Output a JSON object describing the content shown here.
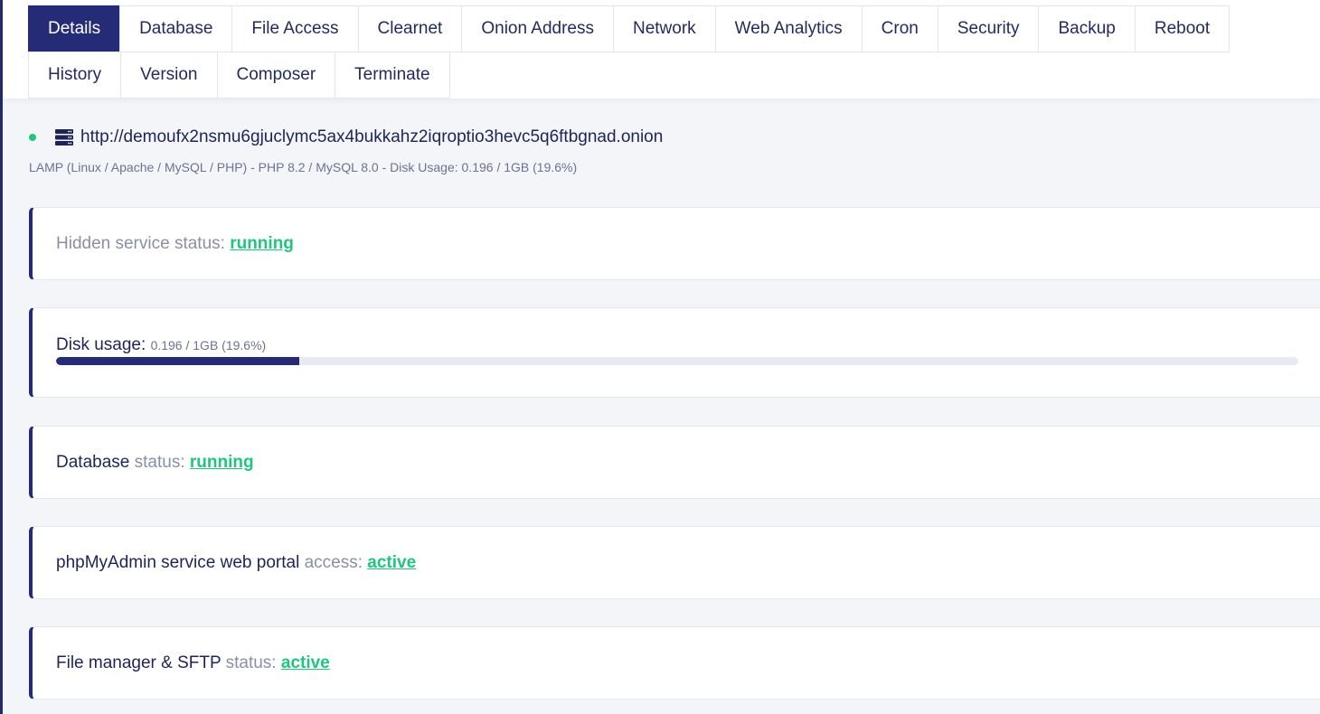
{
  "tabs_row1": [
    "Details",
    "Database",
    "File Access",
    "Clearnet",
    "Onion Address",
    "Network",
    "Web Analytics",
    "Cron",
    "Security",
    "Backup",
    "Reboot"
  ],
  "tabs_row2": [
    "History",
    "Version",
    "Composer",
    "Terminate"
  ],
  "active_tab": "Details",
  "server": {
    "url": "http://demoufx2nsmu6gjuclymc5ax4bukkahz2iqroptio3hevc5q6ftbgnad.onion",
    "info": "LAMP (Linux / Apache / MySQL / PHP) - PHP 8.2 / MySQL 8.0 - Disk Usage: 0.196 / 1GB (19.6%)",
    "status_color": "#1fc67e",
    "icon": "server-icon"
  },
  "hidden_service": {
    "label": "Hidden service status:",
    "status": "running"
  },
  "disk": {
    "label": "Disk usage",
    "separator": ":",
    "value": "0.196 / 1GB (19.6%)",
    "percent": 19.6
  },
  "database": {
    "label": "Database",
    "muted": "status:",
    "status": "running"
  },
  "phpmyadmin": {
    "label": "phpMyAdmin service web portal",
    "muted": "access:",
    "status": "active"
  },
  "file_manager": {
    "label": "File manager & SFTP",
    "muted": "status:",
    "status": "active"
  },
  "colors": {
    "accent": "#262b78",
    "success": "#1fc67e",
    "text": "#1e2456",
    "muted": "#8a8fa6"
  }
}
